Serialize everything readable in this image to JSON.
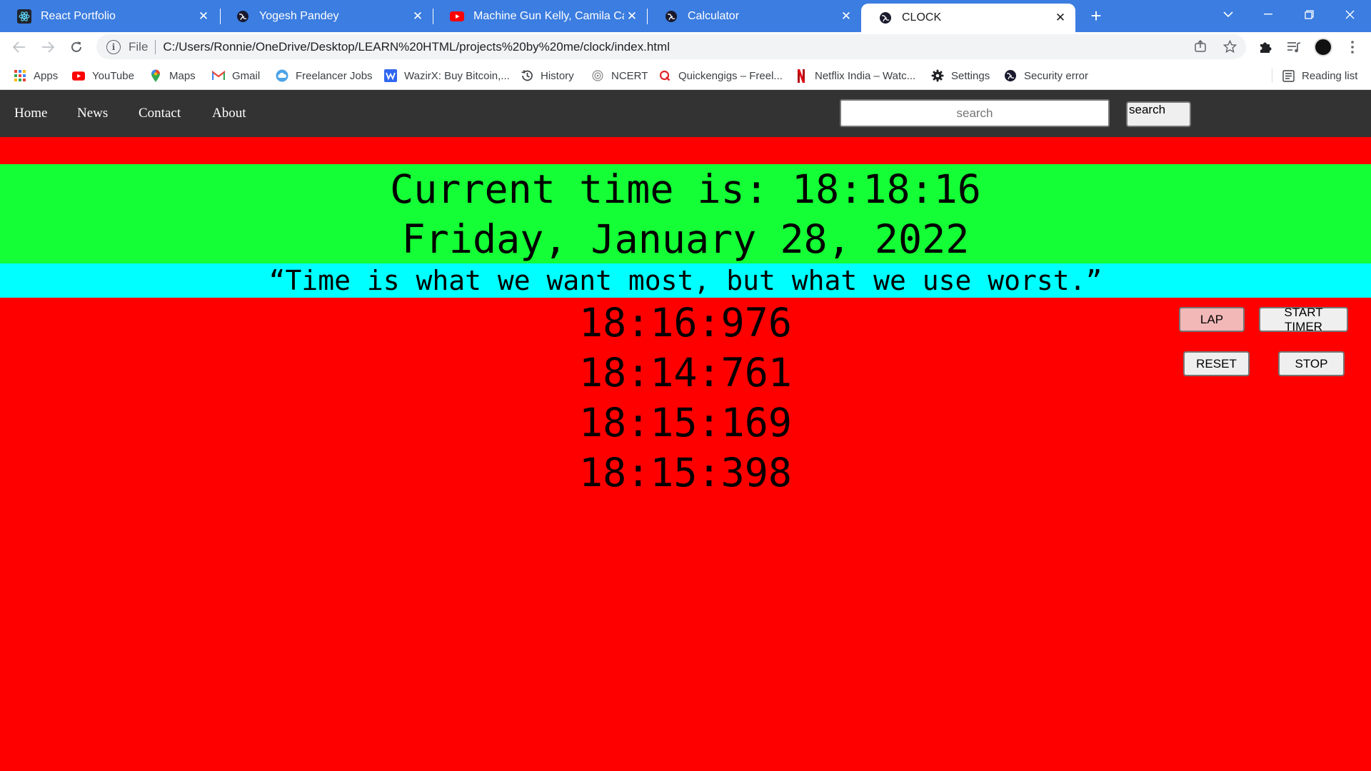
{
  "browser": {
    "tabs": [
      {
        "title": "React Portfolio",
        "icon": "react-icon"
      },
      {
        "title": "Yogesh Pandey",
        "icon": "globe-icon"
      },
      {
        "title": "Machine Gun Kelly, Camila Cabel",
        "icon": "youtube-icon"
      },
      {
        "title": "Calculator",
        "icon": "globe-icon"
      },
      {
        "title": "CLOCK",
        "icon": "globe-icon",
        "active": true
      }
    ],
    "address": {
      "scheme_label": "File",
      "url": "C:/Users/Ronnie/OneDrive/Desktop/LEARN%20HTML/projects%20by%20me/clock/index.html"
    },
    "bookmarks": [
      {
        "label": "Apps",
        "icon": "apps-grid-icon"
      },
      {
        "label": "YouTube",
        "icon": "youtube-icon"
      },
      {
        "label": "Maps",
        "icon": "maps-pin-icon"
      },
      {
        "label": "Gmail",
        "icon": "gmail-icon"
      },
      {
        "label": "Freelancer Jobs",
        "icon": "cloud-icon"
      },
      {
        "label": "WazirX: Buy Bitcoin,...",
        "icon": "wazirx-icon"
      },
      {
        "label": "History",
        "icon": "history-icon"
      },
      {
        "label": "NCERT",
        "icon": "ncert-icon"
      },
      {
        "label": "Quickengigs – Freel...",
        "icon": "quickengigs-icon"
      },
      {
        "label": "Netflix India – Watc...",
        "icon": "netflix-icon"
      },
      {
        "label": "Settings",
        "icon": "gear-icon"
      },
      {
        "label": "Security error",
        "icon": "globe-icon"
      }
    ],
    "reading_list_label": "Reading list"
  },
  "page": {
    "nav": {
      "links": [
        "Home",
        "News",
        "Contact",
        "About"
      ],
      "search_placeholder": "search",
      "search_button_label": "search"
    },
    "current_time_text": "Current time is: 18:18:16",
    "date_text": "Friday, January 28, 2022",
    "quote": "“Time is what we want most, but what we use worst.”",
    "laps": [
      "18:16:976",
      "18:14:761",
      "18:15:169",
      "18:15:398"
    ],
    "controls": {
      "lap_label": "LAP",
      "start_label": "START TIMER",
      "reset_label": "RESET",
      "stop_label": "STOP"
    }
  },
  "colors": {
    "tabstrip": "#3b7de0",
    "navbar": "#333333",
    "page_background": "#ff0000",
    "time_band": "#14ff35",
    "quote_band": "#00ffff",
    "lap_button": "#f2b8b8"
  }
}
